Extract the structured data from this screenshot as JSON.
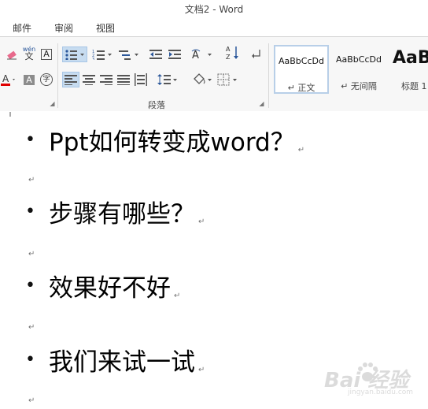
{
  "window": {
    "title": "文档2 - Word"
  },
  "tabs": [
    {
      "label": "邮件"
    },
    {
      "label": "审阅"
    },
    {
      "label": "视图"
    }
  ],
  "ribbon": {
    "font_group": {
      "wen_glyph": "wén",
      "wen_char": "文",
      "char_border": "A",
      "shade_char": "A",
      "enclose_char": "字"
    },
    "paragraph_group": {
      "label": "段落"
    },
    "styles": [
      {
        "sample": "AaBbCcDd",
        "name": "↵ 正文"
      },
      {
        "sample": "AaBbCcDd",
        "name": "↵ 无间隔"
      },
      {
        "sample": "AaB",
        "name": "标题 1"
      }
    ]
  },
  "document": {
    "lines": [
      {
        "bullet": "•",
        "text": "Ppt如何转变成word？"
      },
      {
        "bullet": "•",
        "text": "步骤有哪些？"
      },
      {
        "bullet": "•",
        "text": "效果好不好"
      },
      {
        "bullet": "•",
        "text": "我们来试一试"
      }
    ],
    "para_mark": "↵"
  },
  "watermark": {
    "text": "Bai 经验",
    "sub": "jingyan.baidu.com"
  },
  "colors": {
    "accent": "#2b579a",
    "selected_fill": "#c7dcf0",
    "font_color_red": "#e00000"
  }
}
